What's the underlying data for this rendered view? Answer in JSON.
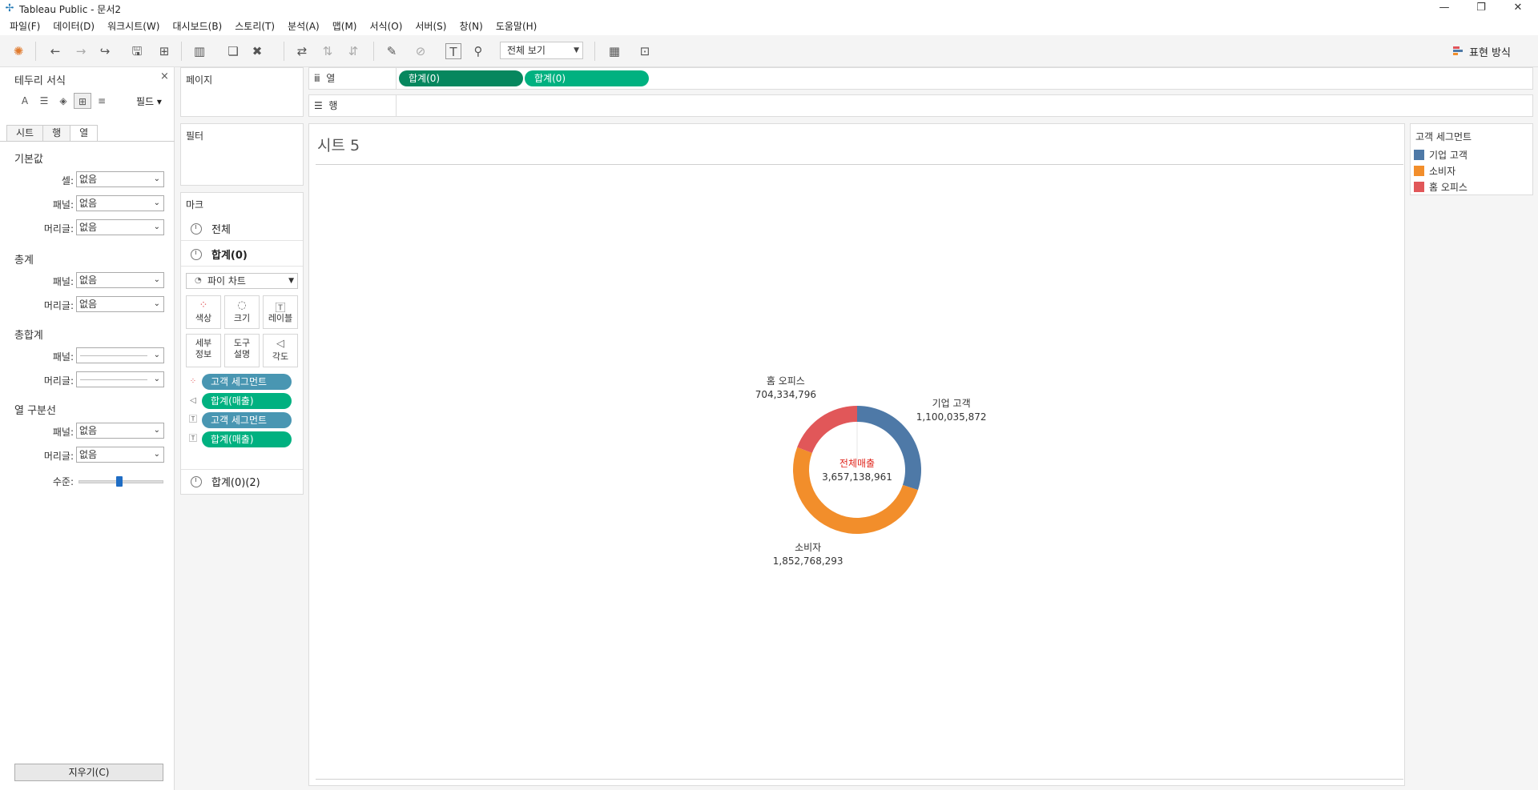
{
  "app": {
    "title": "Tableau Public - 문서2"
  },
  "menu": [
    "파일(F)",
    "데이터(D)",
    "워크시트(W)",
    "대시보드(B)",
    "스토리(T)",
    "분석(A)",
    "맵(M)",
    "서식(O)",
    "서버(S)",
    "창(N)",
    "도움말(H)"
  ],
  "toolbar": {
    "view_option": "전체 보기",
    "show_me": "표현 방식"
  },
  "format_pane": {
    "title": "테두리 서식",
    "fields_button": "필드",
    "tabs": [
      "시트",
      "행",
      "열"
    ],
    "sections": {
      "default": "기본값",
      "totals": "총계",
      "grand_totals": "총합계",
      "col_divider": "열 구분선"
    },
    "labels": {
      "cell": "셀:",
      "pane": "패널:",
      "header": "머리글:",
      "level": "수준:"
    },
    "none": "없음",
    "clear_button": "지우기(C)"
  },
  "cards": {
    "pages": "페이지",
    "filters": "필터",
    "marks": "마크",
    "mark_all": "전체",
    "mark_sum1": "합계(0)",
    "mark_sum2": "합계(0)(2)",
    "mark_type": "파이 차트",
    "tiles": {
      "color": "색상",
      "size": "크기",
      "label": "레이블",
      "detail": "세부\n정보",
      "tooltip": "도구\n설명",
      "angle": "각도"
    },
    "pills": [
      "고객 세그먼트",
      "합계(매출)",
      "고객 세그먼트",
      "합계(매출)"
    ]
  },
  "shelves": {
    "columns_label": "열",
    "rows_label": "행",
    "col_pills": [
      "합계(0)",
      "합계(0)"
    ]
  },
  "view": {
    "sheet_title": "시트 5"
  },
  "legend": {
    "title": "고객 세그먼트"
  },
  "colors": {
    "blue": "#4e79a7",
    "orange": "#f28e2b",
    "red": "#e15759",
    "green_dark": "#06875e",
    "green": "#00b180",
    "teal": "#4996b2"
  },
  "chart_data": {
    "type": "pie",
    "subtype": "donut",
    "categories": [
      "기업 고객",
      "소비자",
      "홈 오피스"
    ],
    "values": [
      1100035872,
      1852768293,
      704334796
    ],
    "value_labels": [
      "1,100,035,872",
      "1,852,768,293",
      "704,334,796"
    ],
    "colors": [
      "#4e79a7",
      "#f28e2b",
      "#e15759"
    ],
    "center_title": "전체매출",
    "center_value": "3,657,138,961"
  }
}
